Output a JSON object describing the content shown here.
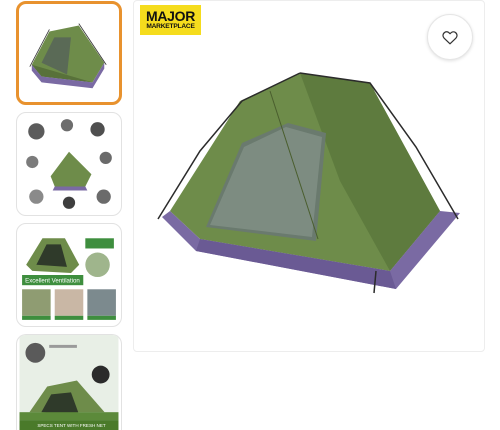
{
  "thumbnails": [
    {
      "name": "tent-front-view",
      "selected": true
    },
    {
      "name": "tent-features-detail",
      "selected": false
    },
    {
      "name": "tent-ventilation",
      "selected": false,
      "feature_title": "Excellent Ventilation"
    },
    {
      "name": "tent-uv-waterproof",
      "selected": false,
      "banner_text": "SPECS TENT WITH FRESH NET"
    }
  ],
  "brand": {
    "top": "MAJOR",
    "bottom": "MARKETPLACE",
    "color": "#f5dc1d"
  },
  "wishlist": {
    "icon": "heart-icon"
  },
  "colors": {
    "tent_green": "#6e8c4a",
    "tent_purple": "#7a6aa3",
    "selected_border": "#e8922e"
  }
}
